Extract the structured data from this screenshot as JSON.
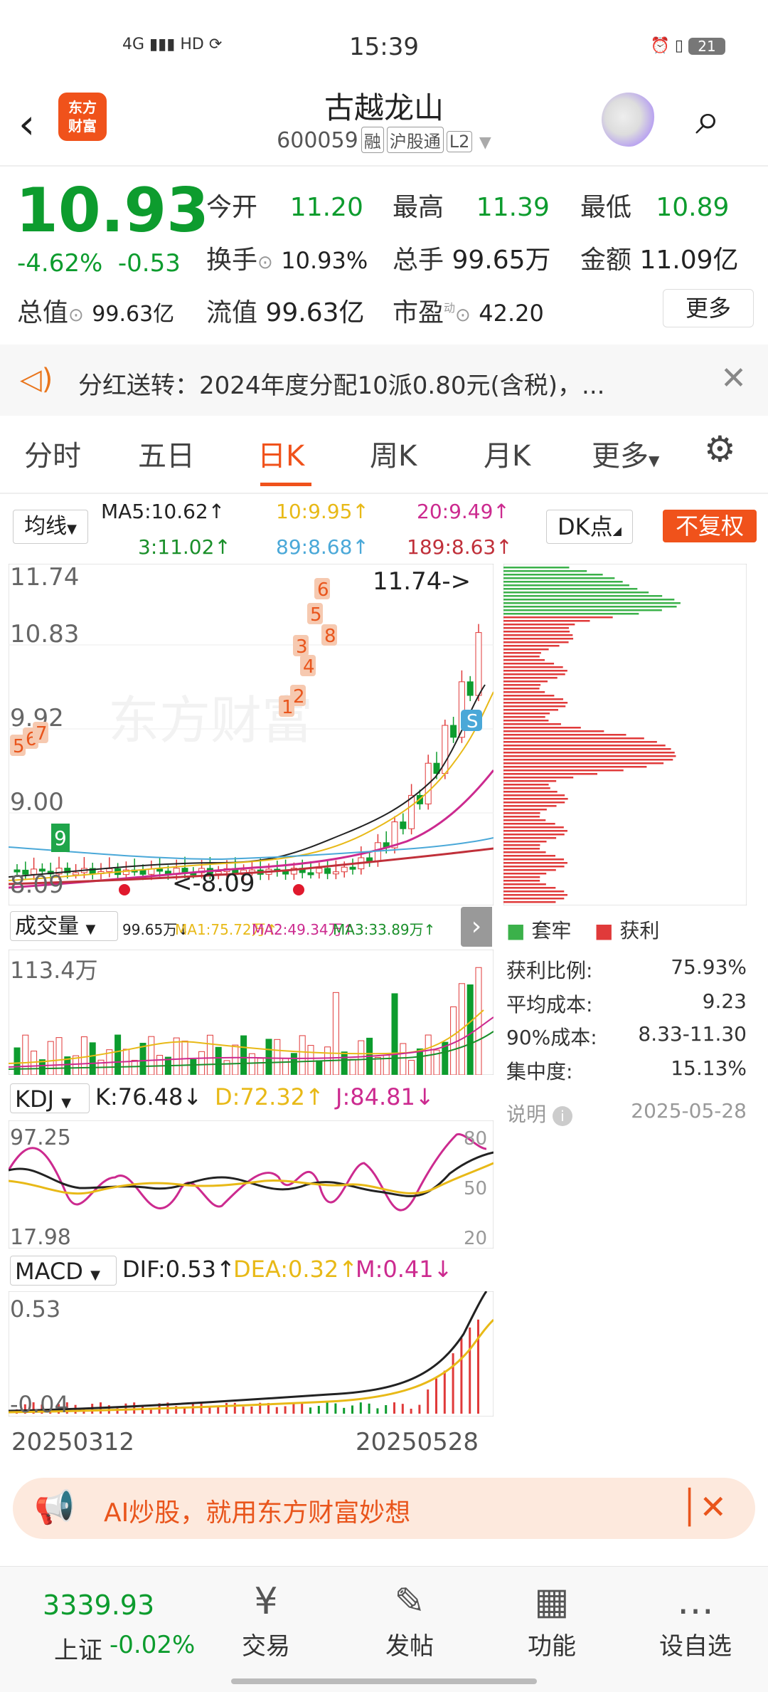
{
  "status_bar": {
    "time": "15:39",
    "network": "4G",
    "hd": "HD",
    "battery": "21"
  },
  "header": {
    "back": "‹",
    "logo_line1": "东方",
    "logo_line2": "财富",
    "title": "古越龙山",
    "code": "600059",
    "tags": [
      "融",
      "沪股通",
      "L2"
    ]
  },
  "quote": {
    "price": "10.93",
    "change_pct": "-4.62%",
    "change": "-0.53",
    "fields": [
      {
        "label": "今开",
        "value": "11.20"
      },
      {
        "label": "最高",
        "value": "11.39"
      },
      {
        "label": "最低",
        "value": "10.89"
      },
      {
        "label": "换手",
        "value": "10.93%"
      },
      {
        "label": "总手",
        "value": "99.65万"
      },
      {
        "label": "金额",
        "value": "11.09亿"
      },
      {
        "label": "总值",
        "value": "99.63亿"
      },
      {
        "label": "流值",
        "value": "99.63亿"
      },
      {
        "label": "市盈",
        "value": "42.20"
      }
    ],
    "pe_sup": "动",
    "more_label": "更多"
  },
  "notice": {
    "text": "分红送转：2024年度分配10派0.80元(含税)，..."
  },
  "tabs": {
    "items": [
      "分时",
      "五日",
      "日K",
      "周K",
      "月K",
      "更多"
    ],
    "active": "日K"
  },
  "ma": {
    "selector": "均线",
    "ma5": "MA5:10.62↑",
    "ma10": "10:9.95↑",
    "ma20": "20:9.49↑",
    "ma3": "3:11.02↑",
    "ma89": "89:8.68↑",
    "ma189": "189:8.63↑",
    "dk_label": "DK点",
    "fq_label": "不复权"
  },
  "kline": {
    "high_label": "11.74",
    "mid1": "10.83",
    "mid2": "9.92",
    "mid3": "9.00",
    "low_label": "8.09",
    "max_marker": "11.74->",
    "min_marker": "<-8.09",
    "watermark": "东方财富"
  },
  "volume": {
    "selector": "成交量",
    "vol": "99.65万↓",
    "ma1": "MA1:75.72万↑",
    "ma2": "MA2:49.34万↑",
    "ma3": "MA3:33.89万↑",
    "max_label": "113.4万"
  },
  "kdj": {
    "selector": "KDJ",
    "k": "K:76.48↓",
    "d": "D:72.32↑",
    "j": "J:84.81↓",
    "top": "97.25",
    "bottom": "17.98",
    "l80": "80",
    "l50": "50",
    "l20": "20"
  },
  "macd": {
    "selector": "MACD",
    "dif": "DIF:0.53↑",
    "dea": "DEA:0.32↑",
    "m": "M:0.41↓",
    "top": "0.53",
    "bottom": "-0.04"
  },
  "dates": {
    "start": "20250312",
    "end": "20250528"
  },
  "chips": {
    "legend_trapped": "套牢",
    "legend_profit": "获利",
    "rows": [
      {
        "label": "获利比例:",
        "value": "75.93%"
      },
      {
        "label": "平均成本:",
        "value": "9.23"
      },
      {
        "label": "90%成本:",
        "value": "8.33-11.30"
      },
      {
        "label": "集中度:",
        "value": "15.13%"
      }
    ],
    "note": "说明",
    "date": "2025-05-28"
  },
  "ai_banner": {
    "text": "AI炒股，就用东方财富妙想"
  },
  "bottom_nav": {
    "index_value": "3339.93",
    "index_name": "上证",
    "index_change": "-0.02%",
    "items": [
      {
        "label": "交易",
        "icon": "¥"
      },
      {
        "label": "发帖",
        "icon": "✎"
      },
      {
        "label": "功能",
        "icon": "▦"
      },
      {
        "label": "设自选",
        "icon": "…"
      }
    ]
  },
  "colors": {
    "up": "#e03a3a",
    "down": "#0d9c2e",
    "accent": "#f0521b",
    "ma5": "#222222",
    "ma10": "#e8b917",
    "ma20": "#cc2a8f",
    "ma3": "#1a8f2a",
    "ma89": "#4aa8d8",
    "ma189": "#c0303a"
  }
}
